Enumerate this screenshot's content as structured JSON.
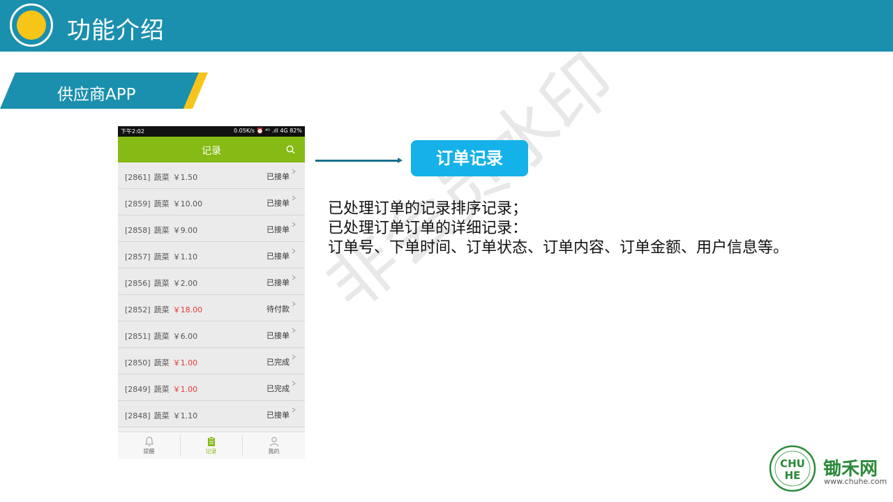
{
  "header": {
    "title": "功能介绍"
  },
  "section": {
    "label": "供应商APP"
  },
  "watermark": "非会员水印",
  "phone": {
    "status_left": "下午2:02",
    "status_right": "0.05K/s ⏰ ⁴ᴳ .ıll 4G 82%",
    "appbar_title": "记录",
    "rows": [
      {
        "id": "[2861]",
        "name": "蔬菜",
        "price": "￥1.50",
        "status": "已接单",
        "price_color": "normal"
      },
      {
        "id": "[2859]",
        "name": "蔬菜",
        "price": "￥10.00",
        "status": "已接单",
        "price_color": "normal"
      },
      {
        "id": "[2858]",
        "name": "蔬菜",
        "price": "￥9.00",
        "status": "已接单",
        "price_color": "normal"
      },
      {
        "id": "[2857]",
        "name": "蔬菜",
        "price": "￥1.10",
        "status": "已接单",
        "price_color": "normal"
      },
      {
        "id": "[2856]",
        "name": "蔬菜",
        "price": "￥2.00",
        "status": "已接单",
        "price_color": "normal"
      },
      {
        "id": "[2852]",
        "name": "蔬菜",
        "price": "￥18.00",
        "status": "待付款",
        "price_color": "red"
      },
      {
        "id": "[2851]",
        "name": "蔬菜",
        "price": "￥6.00",
        "status": "已接单",
        "price_color": "normal"
      },
      {
        "id": "[2850]",
        "name": "蔬菜",
        "price": "￥1.00",
        "status": "已完成",
        "price_color": "red"
      },
      {
        "id": "[2849]",
        "name": "蔬菜",
        "price": "￥1.00",
        "status": "已完成",
        "price_color": "red"
      },
      {
        "id": "[2848]",
        "name": "蔬菜",
        "price": "￥1.10",
        "status": "已接单",
        "price_color": "normal"
      }
    ],
    "tabs": [
      {
        "label": "提醒",
        "icon": "bell-icon"
      },
      {
        "label": "记录",
        "icon": "clipboard-icon"
      },
      {
        "label": "我的",
        "icon": "user-icon"
      }
    ]
  },
  "callout": {
    "label": "订单记录"
  },
  "description": [
    "已处理订单的记录排序记录；",
    "已处理订单订单的详细记录：",
    "订单号、下单时间、订单状态、订单内容、订单金额、用户信息等。"
  ],
  "logo": {
    "name": "锄禾网",
    "url": "www.chuhe.com"
  },
  "colors": {
    "header": "#1b8fae",
    "accent_yellow": "#f6c518",
    "appbar_green": "#86bb15",
    "callout_blue": "#14b2e8",
    "price_red": "#e53935"
  }
}
